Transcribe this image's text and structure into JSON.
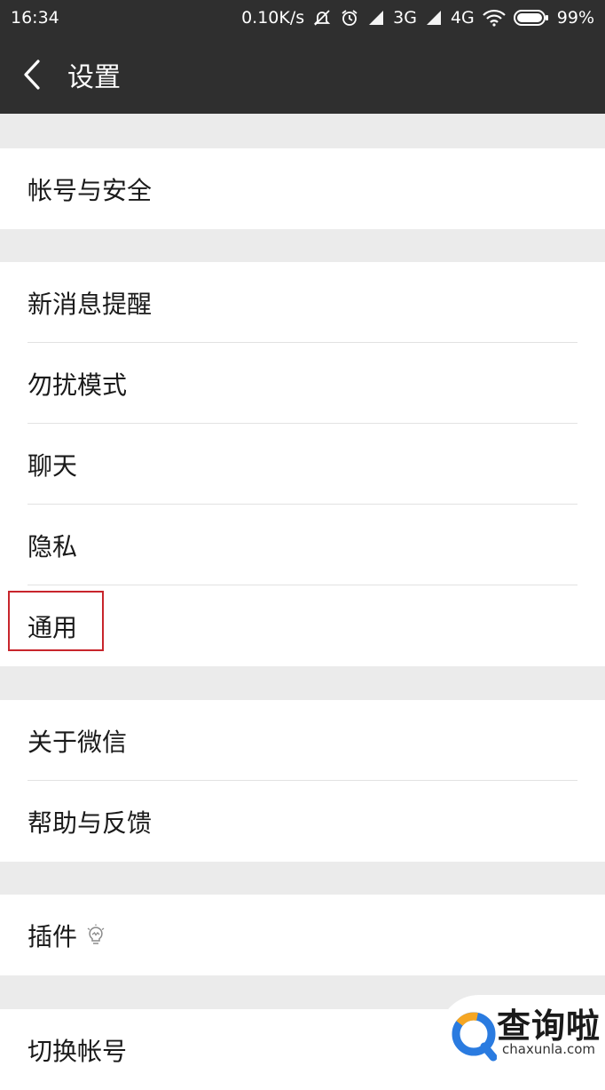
{
  "status_bar": {
    "time": "16:34",
    "net_speed": "0.10K/s",
    "sim1_label": "3G",
    "sim2_label": "4G",
    "battery": "99%",
    "icons": [
      "mute-icon",
      "alarm-icon",
      "signal-icon",
      "wifi-icon",
      "battery-icon"
    ]
  },
  "header": {
    "title": "设置",
    "back_icon": "chevron-left-icon",
    "bg_color": "#2f2f2f"
  },
  "groups": [
    {
      "items": [
        {
          "label": "帐号与安全"
        }
      ]
    },
    {
      "items": [
        {
          "label": "新消息提醒"
        },
        {
          "label": "勿扰模式"
        },
        {
          "label": "聊天"
        },
        {
          "label": "隐私"
        },
        {
          "label": "通用",
          "highlighted": true
        }
      ]
    },
    {
      "items": [
        {
          "label": "关于微信"
        },
        {
          "label": "帮助与反馈"
        }
      ]
    },
    {
      "items": [
        {
          "label": "插件",
          "icon": "lightbulb-icon"
        }
      ]
    },
    {
      "items": [
        {
          "label": "切换帐号"
        }
      ]
    }
  ],
  "highlight_color": "#c8252c",
  "watermark": {
    "text": "查询啦",
    "domain": "chaxunla.com"
  }
}
